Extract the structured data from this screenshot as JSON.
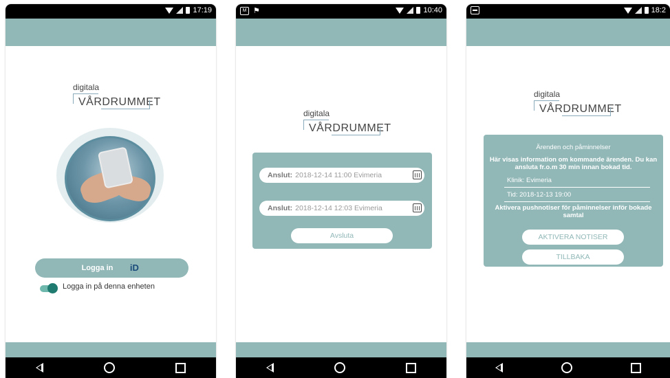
{
  "screens": [
    {
      "status_time": "17:19",
      "logo": {
        "small": "digitala",
        "big": "VÅRDRUMMET"
      },
      "login_button": "Logga in",
      "bankid_icon": "bankid-icon",
      "toggle_label": "Logga in på denna enheten"
    },
    {
      "status_time": "10:40",
      "logo": {
        "small": "digitala",
        "big": "VÅRDRUMMET"
      },
      "appointments": [
        {
          "label": "Anslut:",
          "value": "2018-12-14 11:00 Evimeria"
        },
        {
          "label": "Anslut:",
          "value": "2018-12-14 12:03 Evimeria"
        }
      ],
      "end_button": "Avsluta"
    },
    {
      "status_time": "18:2",
      "logo": {
        "small": "digitala",
        "big": "VÅRDRUMMET"
      },
      "panel_title": "Ärenden och påminnelser",
      "panel_desc": "Här visas information om kommande ärenden. Du kan ansluta fr.o.m 30 min innan bokad tid.",
      "clinic": "Klinik: Evimeria",
      "time": "Tid: 2018-12-13 19:00",
      "notify_text": "Aktivera pushnotiser för påminnelser inför bokade samtal",
      "activate_button": "AKTIVERA NOTISER",
      "back_button": "TILLBAKA"
    }
  ],
  "colors": {
    "accent": "#91b7b7",
    "toggle": "#1f7b70"
  }
}
